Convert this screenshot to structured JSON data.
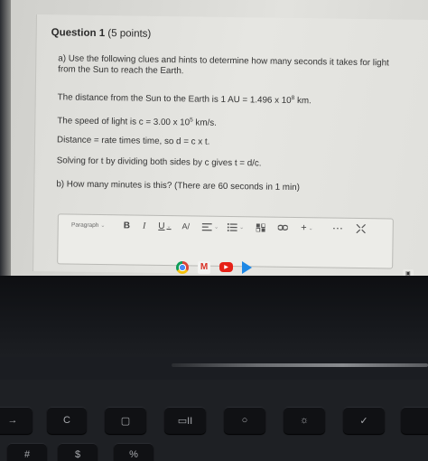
{
  "question": {
    "title": "Question 1",
    "points": "(5 points)",
    "part_a_line1": "a) Use the following clues and hints to determine how many seconds it takes for light",
    "part_a_line2": "from the Sun to reach the Earth.",
    "distance_text": "The distance from the Sun to the Earth is 1 AU = 1.496 x 10",
    "distance_exp": "8",
    "distance_unit": " km.",
    "speed_text": "The speed of light is c = 3.00 x 10",
    "speed_exp": "5",
    "speed_unit": " km/s.",
    "formula_text": "Distance = rate times time, so d = c x t.",
    "solve_text": "Solving for t by dividing both sides by c gives t = d/c.",
    "part_b": "b) How many minutes is this? (There are 60 seconds in 1 min)"
  },
  "editor": {
    "paragraph_label": "Paragraph",
    "bold_label": "B",
    "italic_label": "I",
    "underline_label": "U",
    "color_label": "A/",
    "more_label": "···"
  },
  "shelf": {
    "icons": [
      "chrome-icon",
      "gmail-icon",
      "youtube-icon",
      "play-store-icon"
    ],
    "gmail_glyph": "M"
  },
  "keyboard": {
    "row_top": [
      "→",
      "C",
      "▢",
      "▭II",
      "○",
      "☼",
      "✓"
    ],
    "row_bottom": [
      "#",
      "$",
      "%"
    ]
  }
}
